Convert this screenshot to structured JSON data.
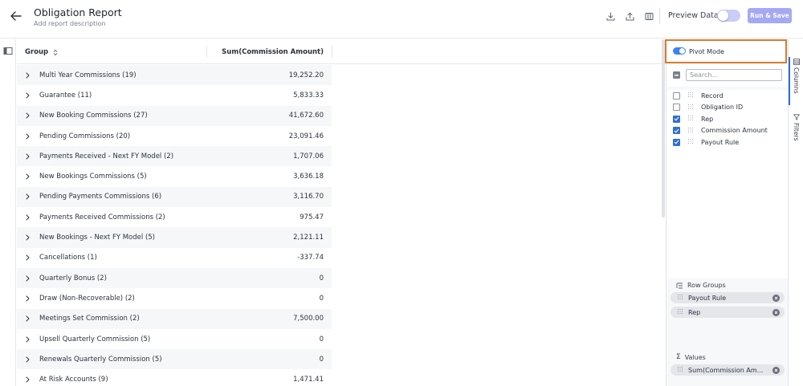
{
  "header": {
    "title": "Obligation Report",
    "subtitle": "Add report description",
    "preview_label": "Preview Data",
    "run_label": "Run & Save"
  },
  "grid": {
    "group_header": "Group",
    "sum_header": "Sum(Commission Amount)",
    "rows": [
      {
        "label": "Multi Year Commissions (19)",
        "value": "19,252.20"
      },
      {
        "label": "Guarantee (11)",
        "value": "5,833.33"
      },
      {
        "label": "New Booking Commissions (27)",
        "value": "41,672.60"
      },
      {
        "label": "Pending Commissions (20)",
        "value": "23,091.46"
      },
      {
        "label": "Payments Received - Next FY Model (2)",
        "value": "1,707.06"
      },
      {
        "label": "New Bookings Commissions (5)",
        "value": "3,636.18"
      },
      {
        "label": "Pending Payments Commissions (6)",
        "value": "3,116.70"
      },
      {
        "label": "Payments Received Commissions (2)",
        "value": "975.47"
      },
      {
        "label": "New Bookings - Next FY Model (5)",
        "value": "2,121.11"
      },
      {
        "label": "Cancellations (1)",
        "value": "-337.74"
      },
      {
        "label": "Quarterly Bonus (2)",
        "value": "0"
      },
      {
        "label": "Draw (Non-Recoverable) (2)",
        "value": "0"
      },
      {
        "label": "Meetings Set Commission (2)",
        "value": "7,500.00"
      },
      {
        "label": "Upsell Quarterly Commission (5)",
        "value": "0"
      },
      {
        "label": "Renewals Quarterly Commission (5)",
        "value": "0"
      },
      {
        "label": "At Risk Accounts (9)",
        "value": "1,471.41"
      }
    ]
  },
  "panel": {
    "pivot_label": "Pivot Mode",
    "search_placeholder": "Search...",
    "columns": [
      {
        "name": "Record",
        "checked": false
      },
      {
        "name": "Obligation ID",
        "checked": false
      },
      {
        "name": "Rep",
        "checked": true
      },
      {
        "name": "Commission Amount",
        "checked": true
      },
      {
        "name": "Payout Rule",
        "checked": true
      }
    ],
    "row_groups_title": "Row Groups",
    "row_groups": [
      "Payout Rule",
      "Rep"
    ],
    "values_title": "Values",
    "values": [
      "Sum(Commission Am..."
    ]
  },
  "tabs": {
    "columns": "Columns",
    "filters": "Filters"
  },
  "colors": {
    "accent": "#2f6fd8",
    "highlight_border": "#d97b2b",
    "run_button": "#a5a9f3"
  }
}
